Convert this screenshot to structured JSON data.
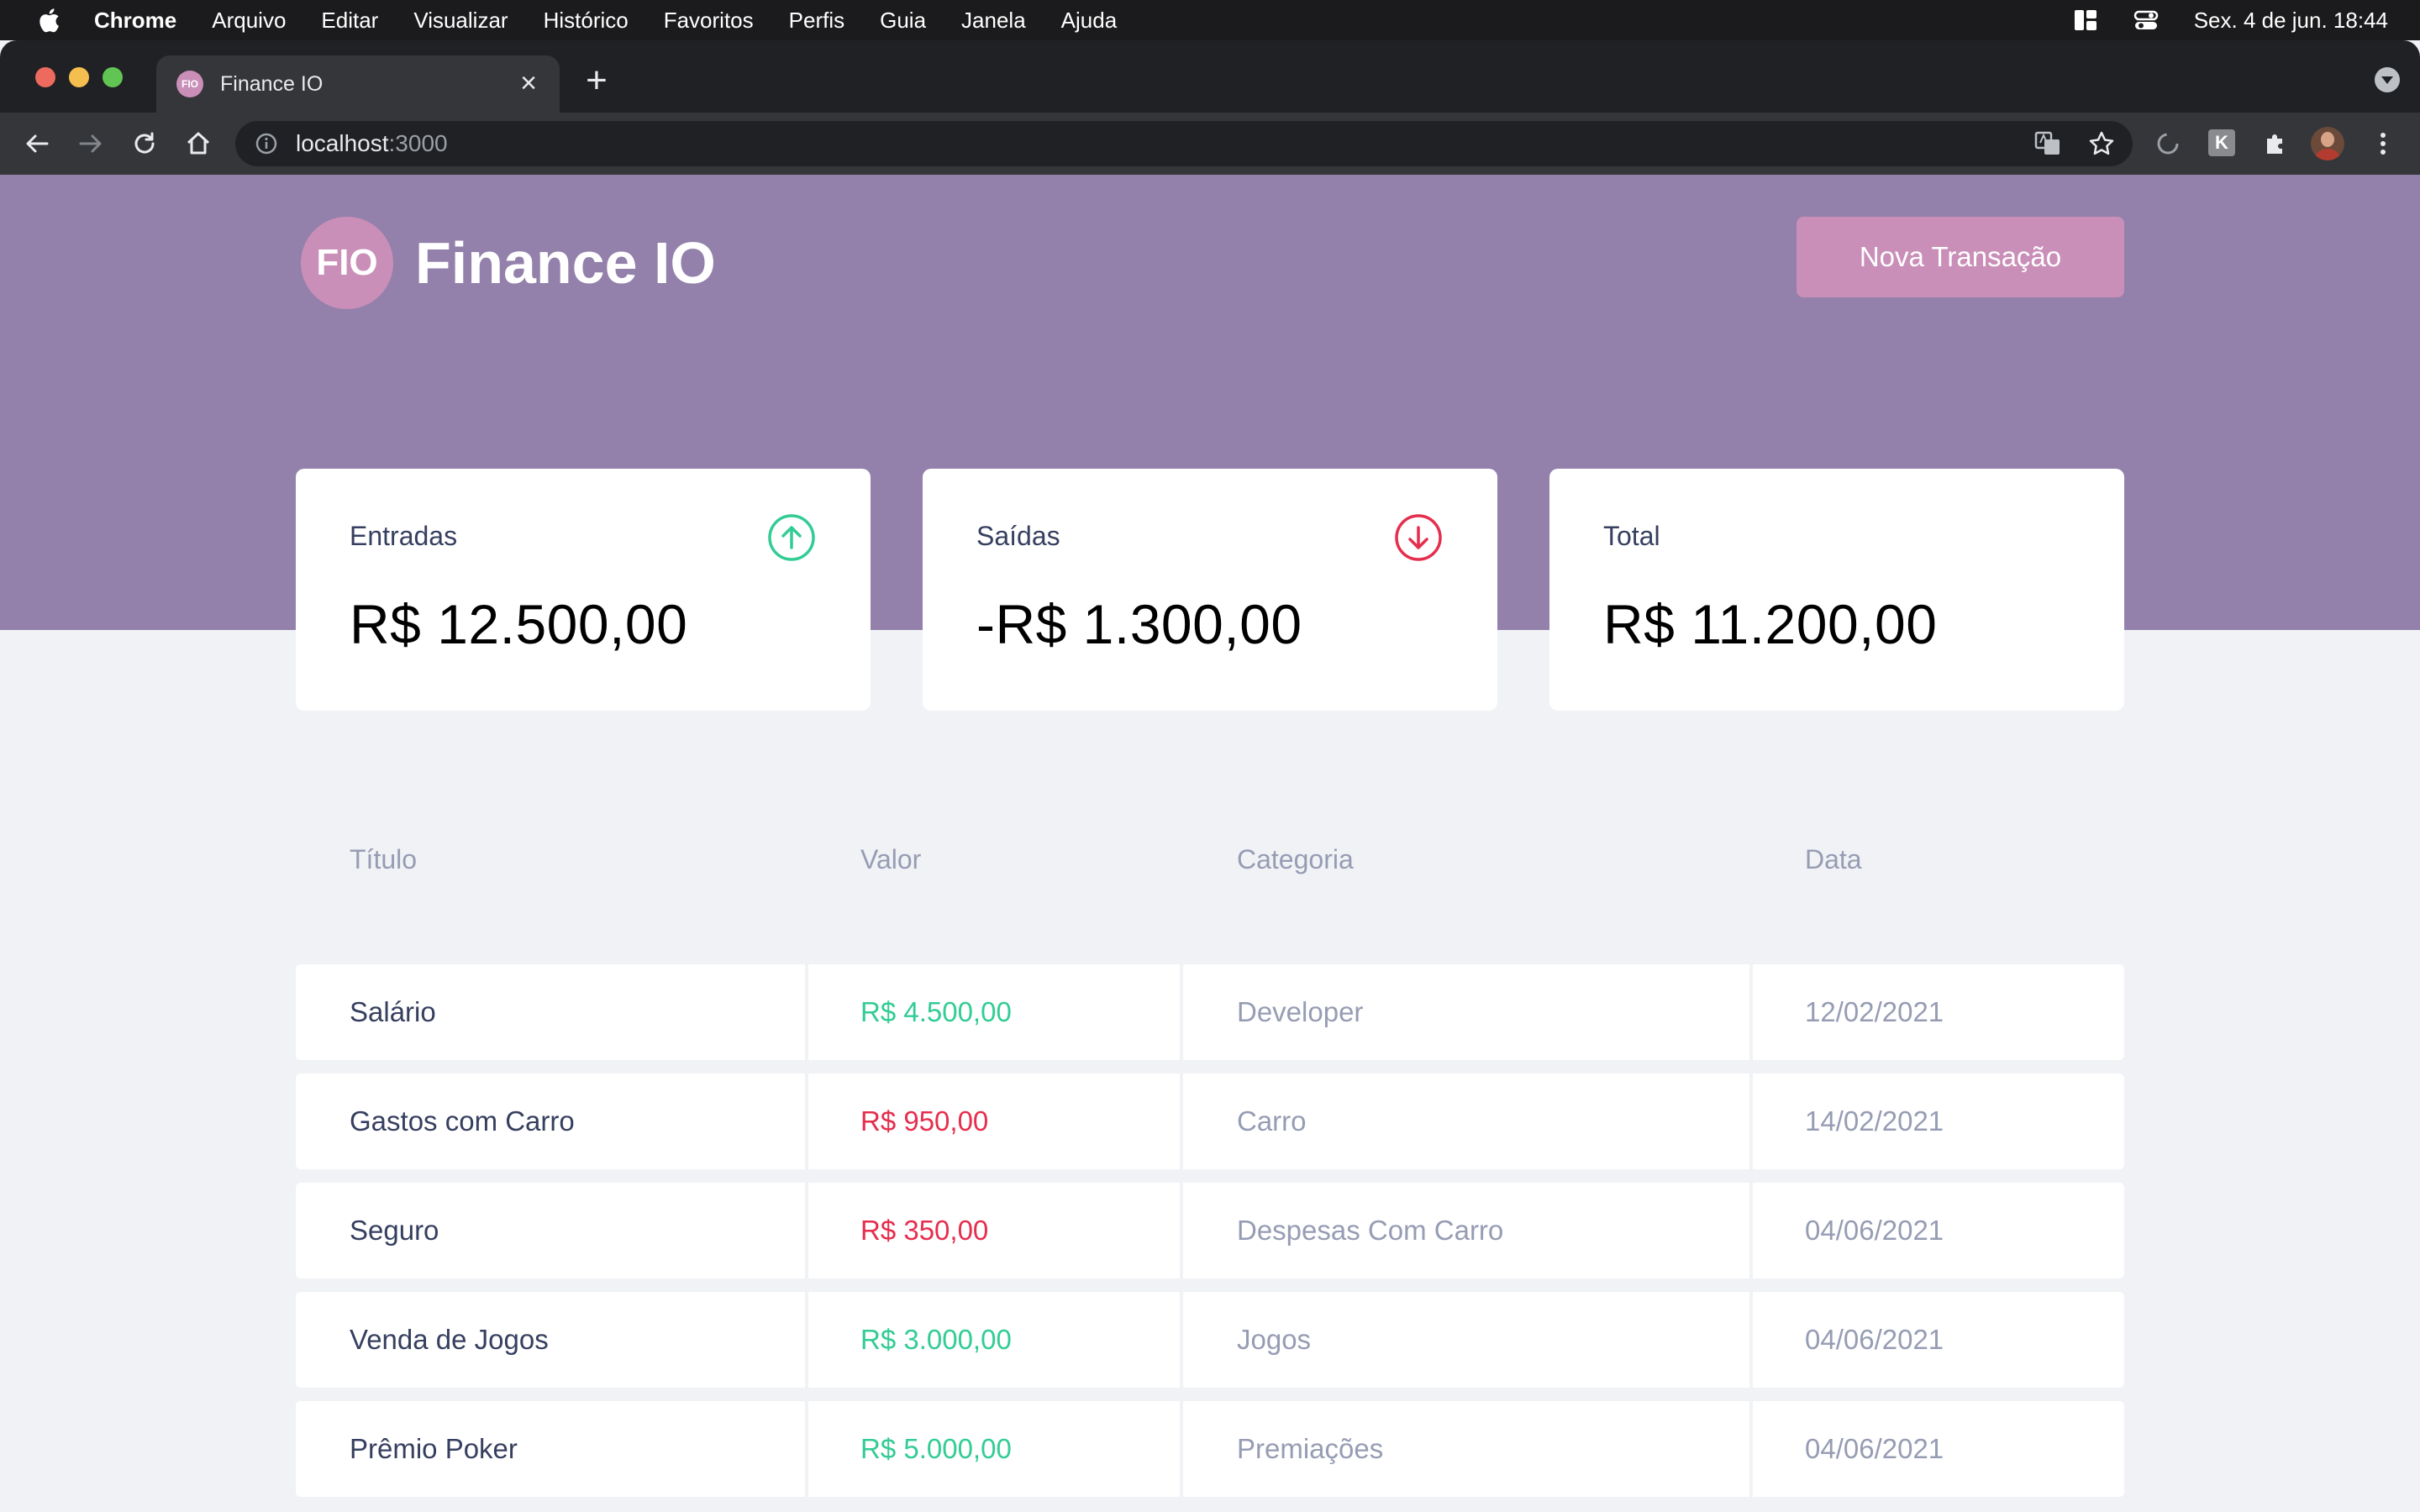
{
  "menubar": {
    "app_name": "Chrome",
    "items": [
      "Arquivo",
      "Editar",
      "Visualizar",
      "Histórico",
      "Favoritos",
      "Perfis",
      "Guia",
      "Janela",
      "Ajuda"
    ],
    "clock": "Sex. 4 de jun.  18:44"
  },
  "browser": {
    "tab_title": "Finance IO",
    "tab_favicon_text": "FIO",
    "url_host": "localhost",
    "url_port": ":3000"
  },
  "header": {
    "logo_text": "FIO",
    "brand_name": "Finance IO",
    "new_transaction_label": "Nova Transação"
  },
  "summary": [
    {
      "label": "Entradas",
      "value": "R$ 12.500,00",
      "icon": "arrow-up-circle-icon",
      "color": "#33cc95"
    },
    {
      "label": "Saídas",
      "value": "-R$ 1.300,00",
      "icon": "arrow-down-circle-icon",
      "color": "#e52e4d"
    },
    {
      "label": "Total",
      "value": "R$ 11.200,00"
    }
  ],
  "table": {
    "headers": [
      "Título",
      "Valor",
      "Categoria",
      "Data"
    ],
    "rows": [
      {
        "title": "Salário",
        "amount": "R$ 4.500,00",
        "type": "deposit",
        "category": "Developer",
        "date": "12/02/2021"
      },
      {
        "title": "Gastos com Carro",
        "amount": "R$ 950,00",
        "type": "withdraw",
        "category": "Carro",
        "date": "14/02/2021"
      },
      {
        "title": "Seguro",
        "amount": "R$ 350,00",
        "type": "withdraw",
        "category": "Despesas Com Carro",
        "date": "04/06/2021"
      },
      {
        "title": "Venda de Jogos",
        "amount": "R$ 3.000,00",
        "type": "deposit",
        "category": "Jogos",
        "date": "04/06/2021"
      },
      {
        "title": "Prêmio Poker",
        "amount": "R$ 5.000,00",
        "type": "deposit",
        "category": "Premiações",
        "date": "04/06/2021"
      }
    ]
  },
  "colors": {
    "header_bg": "#9380ab",
    "accent": "#c98fb8",
    "deposit": "#33cc95",
    "withdraw": "#e52e4d",
    "page_bg": "#f0f2f5"
  }
}
